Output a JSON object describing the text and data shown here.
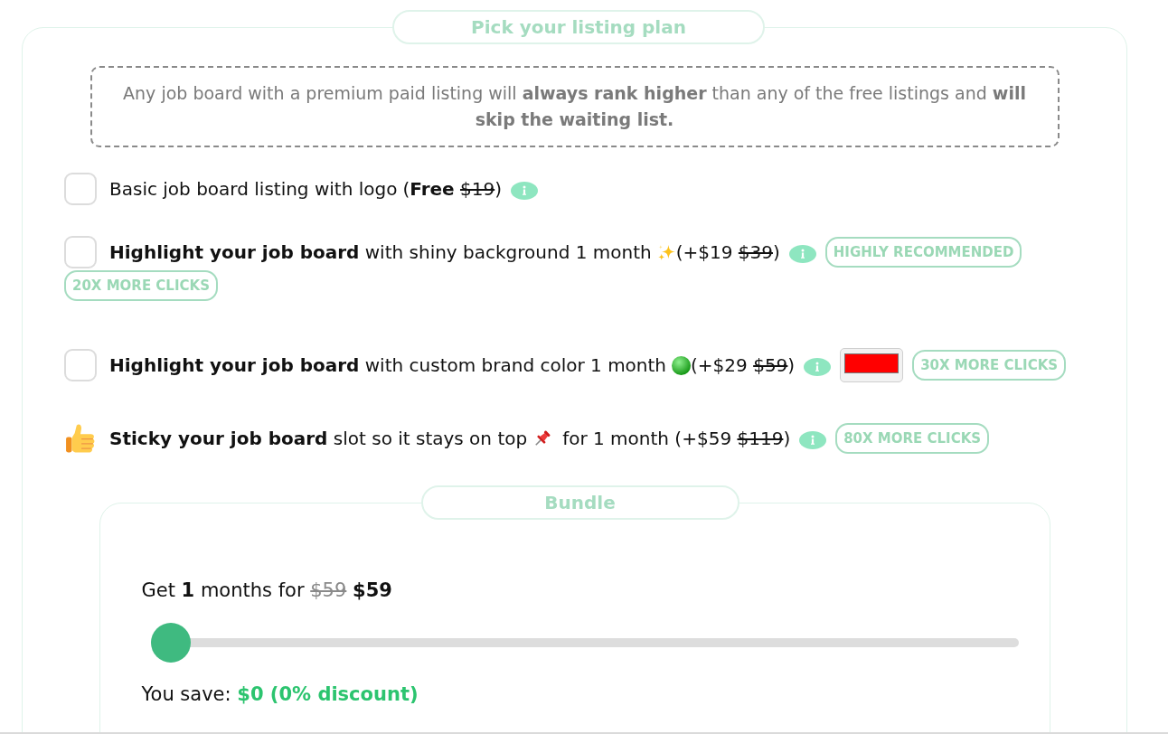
{
  "plan": {
    "title": "Pick your listing plan",
    "notice": "Any job board with a premium paid listing will **always rank higher** than any of the free listings and **will skip the waiting list.**",
    "options": [
      {
        "kind": "checkbox",
        "checked": false,
        "label": "Basic job board listing with logo",
        "tail": "(**Free**",
        "old_price": "$19",
        "tail_end": ")"
      },
      {
        "kind": "checkbox",
        "checked": false,
        "label": "**Highlight your job board** with shiny background 1 month",
        "tail": "(+$19",
        "old_price": "$39",
        "tail_end": ")",
        "badges": [
          "HIGHLY RECOMMENDED",
          "20X MORE CLICKS"
        ]
      },
      {
        "kind": "checkbox",
        "checked": false,
        "label": "**Highlight your job board** with custom brand color 1 month",
        "tail": "(+$29",
        "old_price": "$59",
        "tail_end": ")",
        "color_picker": {
          "color": "#ff0000"
        },
        "badges": [
          "30X MORE CLICKS"
        ]
      },
      {
        "kind": "fixed",
        "label": "**Sticky your job board** slot so it stays on top",
        "tail": "for 1 month (+$59",
        "old_price": "$119",
        "tail_end": ")",
        "badges": [
          "80X MORE CLICKS"
        ]
      }
    ]
  },
  "bundle": {
    "title": "Bundle",
    "summary": "Get **1** months for",
    "old_price": "$59",
    "price": "$59",
    "slider": {
      "level": 0
    },
    "savings_label": "You save:",
    "savings": "$0 (0% discount)"
  }
}
